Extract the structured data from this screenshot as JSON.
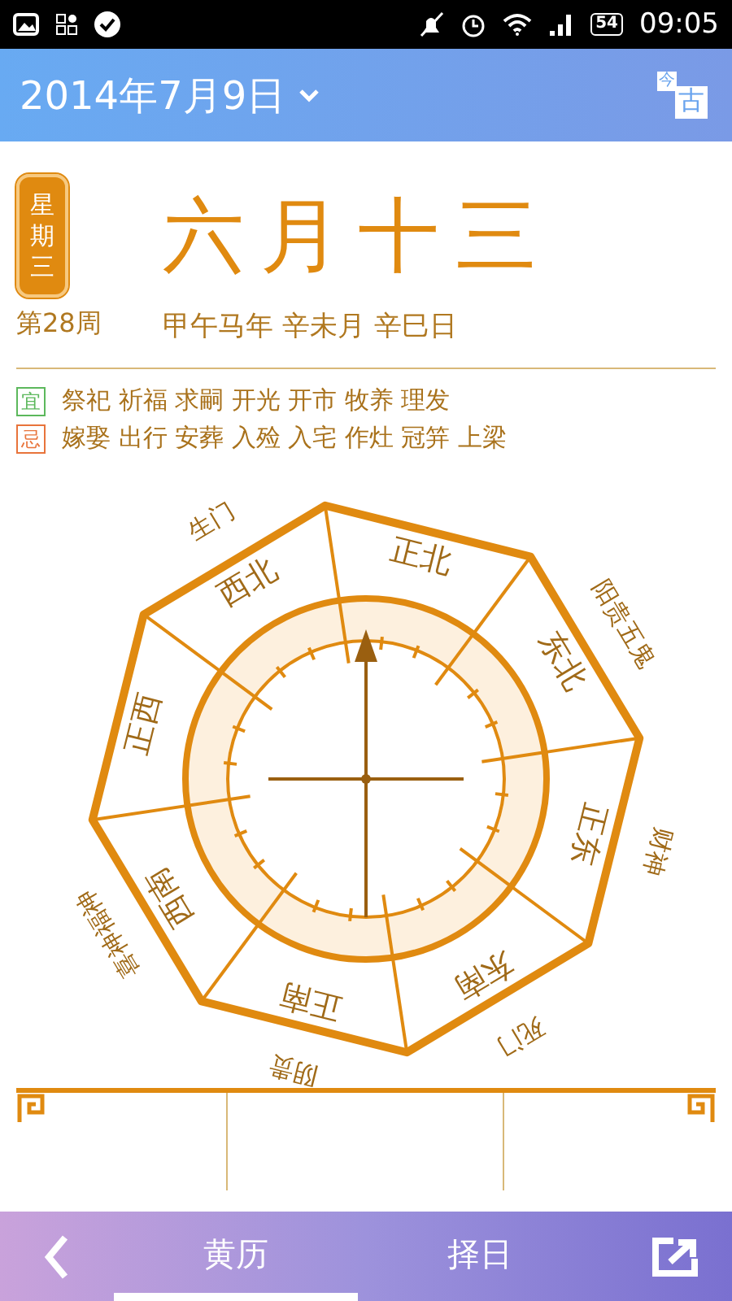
{
  "status_bar": {
    "battery": "54",
    "time": "09:05"
  },
  "header": {
    "date": "2014年7月9日",
    "toggle": {
      "top": "今",
      "bottom": "古"
    }
  },
  "day": {
    "weekday": "星期三",
    "lunar_date": "六月十三",
    "week": "第28周",
    "ganzhi": "甲午马年 辛未月 辛巳日"
  },
  "advice": [
    {
      "badge": "宜",
      "color": "#5cb85c",
      "items": "祭祀 祈福 求嗣 开光 开市 牧养 理发"
    },
    {
      "badge": "忌",
      "color": "#e8743b",
      "items": "嫁娶 出行 安葬 入殓 入宅 作灶 冠笄 上梁"
    }
  ],
  "compass": {
    "sectors": [
      {
        "label": "正北"
      },
      {
        "label": "东北",
        "outer_label": "阳贵五鬼"
      },
      {
        "label": "正东",
        "outer_label": "财神"
      },
      {
        "label": "东南",
        "outer_label": "死门"
      },
      {
        "label": "正南",
        "outer_label": "阴贵"
      },
      {
        "label": "西南",
        "outer_label": "喜神福神"
      },
      {
        "label": "正西"
      },
      {
        "label": "西北",
        "outer_label": "生门"
      }
    ]
  },
  "bottom_nav": {
    "tabs": [
      {
        "label": "黄历",
        "selected": true
      },
      {
        "label": "择日",
        "selected": false
      }
    ]
  }
}
